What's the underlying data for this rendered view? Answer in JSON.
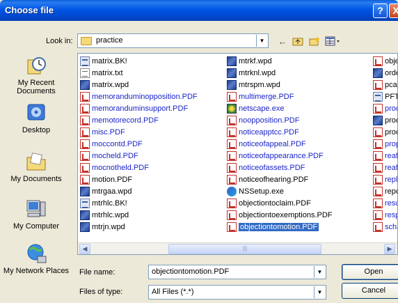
{
  "window": {
    "title": "Choose file"
  },
  "lookin": {
    "label": "Look in:",
    "value": "practice"
  },
  "places": [
    {
      "label": "My Recent Documents",
      "icon": "recent-documents-icon"
    },
    {
      "label": "Desktop",
      "icon": "desktop-icon"
    },
    {
      "label": "My Documents",
      "icon": "my-documents-icon"
    },
    {
      "label": "My Computer",
      "icon": "my-computer-icon"
    },
    {
      "label": "My Network Places",
      "icon": "network-places-icon"
    }
  ],
  "files": {
    "col1": [
      {
        "name": "matrix.BK!",
        "type": "bk",
        "blue": false
      },
      {
        "name": "matrix.txt",
        "type": "txt",
        "blue": false
      },
      {
        "name": "matrix.wpd",
        "type": "wpd",
        "blue": false
      },
      {
        "name": "memoranduminopposition.PDF",
        "type": "pdf",
        "blue": true
      },
      {
        "name": "memoranduminsupport.PDF",
        "type": "pdf",
        "blue": true
      },
      {
        "name": "memotorecord.PDF",
        "type": "pdf",
        "blue": true
      },
      {
        "name": "misc.PDF",
        "type": "pdf",
        "blue": true
      },
      {
        "name": "moccontd.PDF",
        "type": "pdf",
        "blue": true
      },
      {
        "name": "mocheld.PDF",
        "type": "pdf",
        "blue": true
      },
      {
        "name": "mocnotheld.PDF",
        "type": "pdf",
        "blue": true
      },
      {
        "name": "motion.PDF",
        "type": "pdf",
        "blue": false
      },
      {
        "name": "mtrgaa.wpd",
        "type": "wpd",
        "blue": false
      },
      {
        "name": "mtrhlc.BK!",
        "type": "bk",
        "blue": false
      },
      {
        "name": "mtrhlc.wpd",
        "type": "wpd",
        "blue": false
      },
      {
        "name": "mtrjn.wpd",
        "type": "wpd",
        "blue": false
      }
    ],
    "col2": [
      {
        "name": "mtrkf.wpd",
        "type": "wpd",
        "blue": false
      },
      {
        "name": "mtrknl.wpd",
        "type": "wpd",
        "blue": false
      },
      {
        "name": "mtrspm.wpd",
        "type": "wpd",
        "blue": false
      },
      {
        "name": "multimerge.PDF",
        "type": "pdf",
        "blue": true
      },
      {
        "name": "netscape.exe",
        "type": "exe1",
        "blue": true
      },
      {
        "name": "noopposition.PDF",
        "type": "pdf",
        "blue": true
      },
      {
        "name": "noticeapptcc.PDF",
        "type": "pdf",
        "blue": true
      },
      {
        "name": "noticeofappeal.PDF",
        "type": "pdf",
        "blue": true
      },
      {
        "name": "noticeofappearance.PDF",
        "type": "pdf",
        "blue": true
      },
      {
        "name": "noticeofassets.PDF",
        "type": "pdf",
        "blue": true
      },
      {
        "name": "noticeofhearing.PDF",
        "type": "pdf",
        "blue": false
      },
      {
        "name": "NSSetup.exe",
        "type": "exe2",
        "blue": false
      },
      {
        "name": "objectiontoclaim.PDF",
        "type": "pdf",
        "blue": false
      },
      {
        "name": "objectiontoexemptions.PDF",
        "type": "pdf",
        "blue": false
      },
      {
        "name": "objectiontomotion.PDF",
        "type": "pdf",
        "blue": false,
        "selected": true
      }
    ],
    "col3": [
      {
        "name": "obje",
        "type": "pdf",
        "blue": false
      },
      {
        "name": "orde",
        "type": "wpd",
        "blue": false
      },
      {
        "name": "pcat",
        "type": "pdf",
        "blue": false
      },
      {
        "name": "PFTE",
        "type": "bk",
        "blue": false
      },
      {
        "name": "proc",
        "type": "pdf",
        "blue": true
      },
      {
        "name": "proc",
        "type": "wpd",
        "blue": false
      },
      {
        "name": "proo",
        "type": "pdf",
        "blue": false
      },
      {
        "name": "prop",
        "type": "pdf",
        "blue": true
      },
      {
        "name": "reafi",
        "type": "pdf",
        "blue": true
      },
      {
        "name": "reafi",
        "type": "pdf",
        "blue": true
      },
      {
        "name": "reply",
        "type": "pdf",
        "blue": true
      },
      {
        "name": "repo",
        "type": "pdf",
        "blue": false
      },
      {
        "name": "resch",
        "type": "pdf",
        "blue": true
      },
      {
        "name": "resp",
        "type": "pdf",
        "blue": true
      },
      {
        "name": "scha",
        "type": "pdf",
        "blue": true
      }
    ]
  },
  "filename": {
    "label": "File name:",
    "value": "objectiontomotion.PDF"
  },
  "filetype": {
    "label": "Files of type:",
    "value": "All Files (*.*)"
  },
  "buttons": {
    "open": "Open",
    "cancel": "Cancel",
    "help": "?",
    "close": "X"
  }
}
